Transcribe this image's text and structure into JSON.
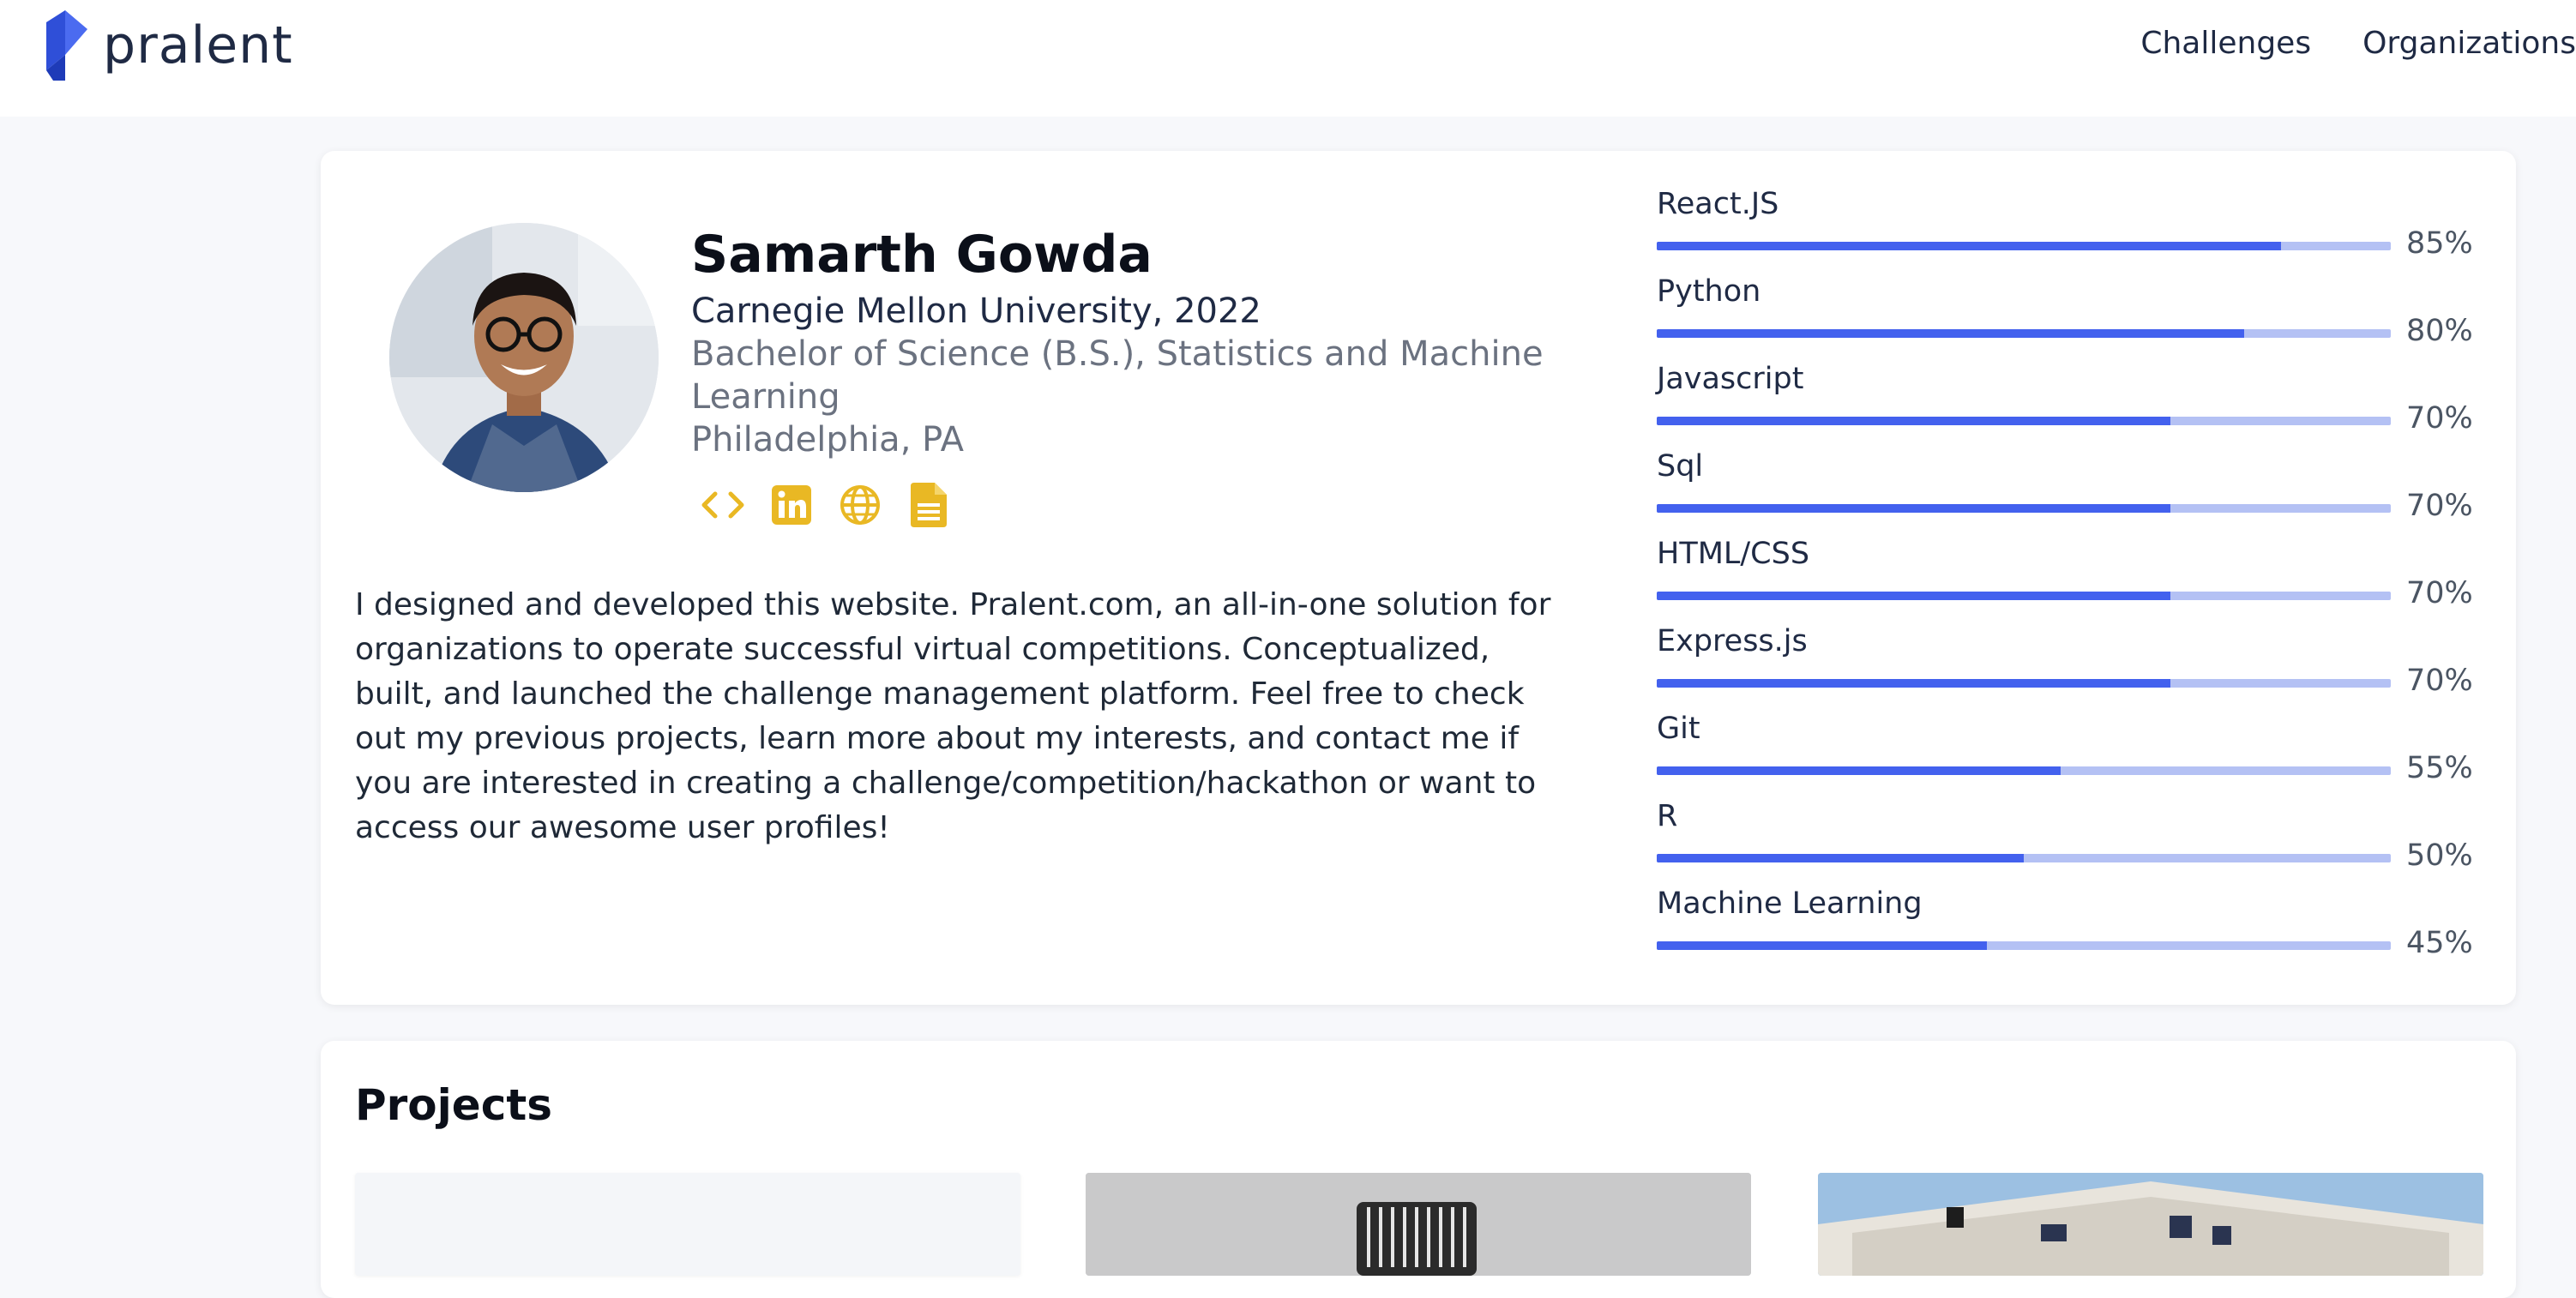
{
  "app": {
    "logo_text": "pralent",
    "brand_color": "#4361ee"
  },
  "nav": {
    "items": [
      "Challenges",
      "Organizations"
    ]
  },
  "profile": {
    "name": "Samarth Gowda",
    "school": "Carnegie Mellon University, 2022",
    "degree": "Bachelor of Science (B.S.), Statistics and Machine Learning",
    "location": "Philadelphia, PA",
    "links": [
      "code-icon",
      "linkedin-icon",
      "globe-icon",
      "resume-icon"
    ],
    "icon_color": "#e9b824",
    "bio": "I designed and developed this website. Pralent.com, an all-in-one solution for organizations to operate successful virtual competitions. Conceptualized, built, and launched the challenge management platform. Feel free to check out my previous projects, learn more about my interests, and contact me if you are interested in creating a challenge/competition/hackathon or want to access our awesome user profiles!"
  },
  "skills": [
    {
      "name": "React.JS",
      "percent": 85,
      "label": "85%"
    },
    {
      "name": "Python",
      "percent": 80,
      "label": "80%"
    },
    {
      "name": "Javascript",
      "percent": 70,
      "label": "70%"
    },
    {
      "name": "Sql",
      "percent": 70,
      "label": "70%"
    },
    {
      "name": "HTML/CSS",
      "percent": 70,
      "label": "70%"
    },
    {
      "name": "Express.js",
      "percent": 70,
      "label": "70%"
    },
    {
      "name": "Git",
      "percent": 55,
      "label": "55%"
    },
    {
      "name": "R",
      "percent": 50,
      "label": "50%"
    },
    {
      "name": "Machine Learning",
      "percent": 45,
      "label": "45%"
    }
  ],
  "projects": {
    "title": "Projects"
  }
}
